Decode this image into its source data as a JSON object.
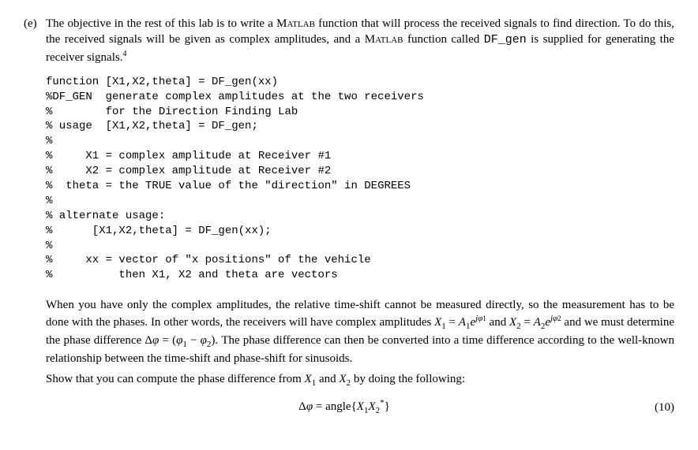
{
  "item": {
    "marker": "(e)",
    "intro_part1": "The objective in the rest of this lab is to write a ",
    "intro_matlab1": "Matlab",
    "intro_part2": " function that will process the received signals to find direction. To do this, the received signals will be given as complex amplitudes, and a ",
    "intro_matlab2": "Matlab",
    "intro_part3": " function called ",
    "intro_tt": "DF_gen",
    "intro_part4": " is supplied for generating the receiver signals.",
    "footnote_mark": "4"
  },
  "code": {
    "l1": "function [X1,X2,theta] = DF_gen(xx)",
    "l2": "%DF_GEN  generate complex amplitudes at the two receivers",
    "l3": "%        for the Direction Finding Lab",
    "l4": "% usage  [X1,X2,theta] = DF_gen;",
    "l5": "%",
    "l6": "%     X1 = complex amplitude at Receiver #1",
    "l7": "%     X2 = complex amplitude at Receiver #2",
    "l8": "%  theta = the TRUE value of the \"direction\" in DEGREES",
    "l9": "%",
    "l10": "% alternate usage:",
    "l11": "%      [X1,X2,theta] = DF_gen(xx);",
    "l12": "%",
    "l13": "%     xx = vector of \"x positions\" of the vehicle",
    "l14": "%          then X1, X2 and theta are vectors"
  },
  "para2": {
    "text": "When you have only the complex amplitudes, the relative time-shift cannot be measured directly, so the measurement has to be done with the phases. In other words, the receivers will have complex amplitudes "
  },
  "math1": {
    "X1": "X",
    "sub1": "1",
    "eq": " = ",
    "A1": "A",
    "Asub1": "1",
    "e": "e",
    "expj": "j",
    "phi1": "φ",
    "phisub1": "1",
    "and": " and ",
    "X2": "X",
    "sub2": "2",
    "A2": "A",
    "Asub2": "2",
    "phi2": "φ",
    "phisub2": "2",
    "tail": " and we must determine the phase difference Δ",
    "phi": "φ",
    "eqparen": " = (",
    "p1": "φ",
    "ps1": "1",
    "minus": " − ",
    "p2": "φ",
    "ps2": "2",
    "close": "). ",
    "tail2": "The phase difference can then be converted into a time difference according to the well-known relationship between the time-shift and phase-shift for sinusoids."
  },
  "prompt": {
    "text_a": "Show that you can compute the phase difference from ",
    "X1": "X",
    "s1": "1",
    "and": " and ",
    "X2": "X",
    "s2": "2",
    "text_b": " by doing the following:"
  },
  "equation": {
    "delta": "Δ",
    "phi": "φ",
    "eq": " = angle{",
    "X1": "X",
    "s1": "1",
    "X2": "X",
    "s2": "2",
    "star": "*",
    "close": "}",
    "number": "(10)"
  }
}
